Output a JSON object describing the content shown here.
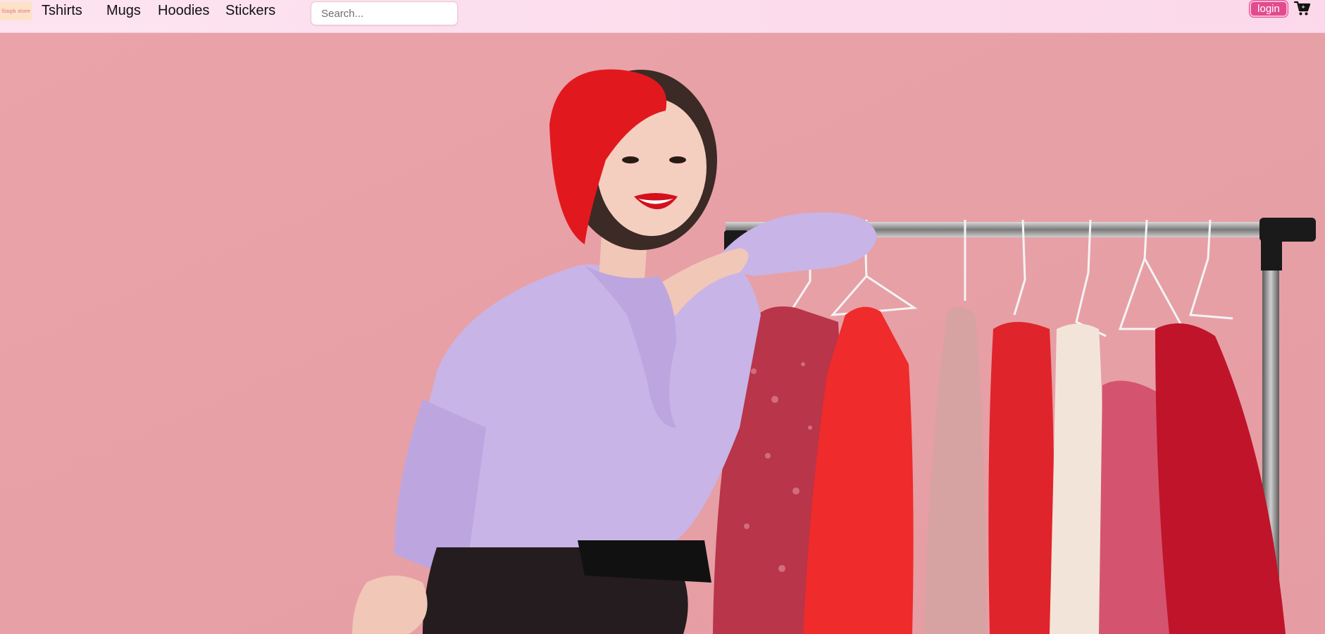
{
  "brand": {
    "logo_text": "Singh store"
  },
  "nav": {
    "links": [
      "Tshirts",
      "Mugs",
      "Hoodies",
      "Stickers"
    ]
  },
  "search": {
    "placeholder": "Search..."
  },
  "actions": {
    "login_label": "login"
  },
  "icons": {
    "cart": "shopping-cart-icon"
  },
  "colors": {
    "navbar_bg": "#fde3f0",
    "accent": "#e24b8e",
    "hero_bg": "#e8a0a6"
  },
  "hero": {
    "image_description": "Woman in red beret and lavender blouse leaning on clothing rack with red dresses"
  }
}
